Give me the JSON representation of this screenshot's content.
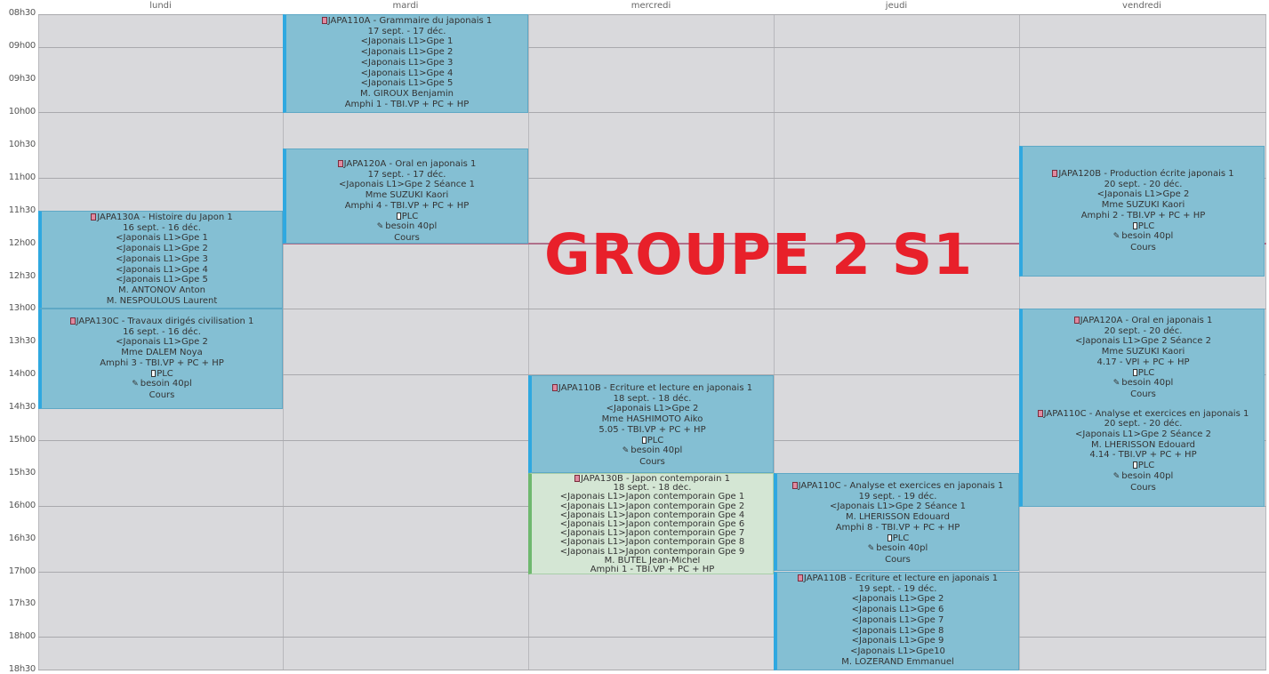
{
  "days": [
    "lundi",
    "mardi",
    "mercredi",
    "jeudi",
    "vendredi"
  ],
  "times": [
    "08h30",
    "09h00",
    "09h30",
    "10h00",
    "10h30",
    "11h00",
    "11h30",
    "12h00",
    "12h30",
    "13h00",
    "13h30",
    "14h00",
    "14h30",
    "15h00",
    "15h30",
    "16h00",
    "16h30",
    "17h00",
    "17h30",
    "18h00",
    "18h30"
  ],
  "overlay_title": "GROUPE 2 S1",
  "events": {
    "mardi_1": {
      "code": "JAPA110A - Grammaire du japonais 1",
      "dates": "17 sept. - 17 déc.",
      "groups": [
        "<Japonais L1>Gpe 1",
        "<Japonais L1>Gpe 2",
        "<Japonais L1>Gpe 3",
        "<Japonais L1>Gpe 4",
        "<Japonais L1>Gpe 5"
      ],
      "teacher": "M. GIROUX Benjamin",
      "room": "Amphi 1 - TBI.VP + PC + HP"
    },
    "mardi_2": {
      "code": "JAPA120A - Oral en japonais 1",
      "dates": "17 sept. - 17 déc.",
      "groups": [
        "<Japonais L1>Gpe 2 Séance 1"
      ],
      "teacher": "Mme SUZUKI Kaori",
      "room": "Amphi 4 - TBI.VP + PC + HP",
      "plc": "PLC",
      "need": "besoin 40pl",
      "type": "Cours"
    },
    "lundi_1": {
      "code": "JAPA130A - Histoire du Japon 1",
      "dates": "16 sept. - 16 déc.",
      "groups": [
        "<Japonais L1>Gpe 1",
        "<Japonais L1>Gpe 2",
        "<Japonais L1>Gpe 3",
        "<Japonais L1>Gpe 4",
        "<Japonais L1>Gpe 5"
      ],
      "teacher": "M. ANTONOV Anton",
      "teacher2": "M. NESPOULOUS Laurent"
    },
    "lundi_2": {
      "code": "JAPA130C - Travaux dirigés civilisation 1",
      "dates": "16 sept. - 16 déc.",
      "groups": [
        "<Japonais L1>Gpe 2"
      ],
      "teacher": "Mme DALEM Noya",
      "room": "Amphi 3 - TBI.VP + PC + HP",
      "plc": "PLC",
      "need": "besoin 40pl",
      "type": "Cours"
    },
    "mercredi_1": {
      "code": "JAPA110B - Ecriture et lecture en japonais 1",
      "dates": "18 sept. - 18 déc.",
      "groups": [
        "<Japonais L1>Gpe 2"
      ],
      "teacher": "Mme HASHIMOTO Aiko",
      "room": "5.05 - TBI.VP + PC + HP",
      "plc": "PLC",
      "need": "besoin 40pl",
      "type": "Cours"
    },
    "mercredi_2": {
      "code": "JAPA130B - Japon contemporain 1",
      "dates": "18 sept. - 18 déc.",
      "groups": [
        "<Japonais L1>Japon contemporain Gpe 1",
        "<Japonais L1>Japon contemporain Gpe 2",
        "<Japonais L1>Japon contemporain Gpe 4",
        "<Japonais L1>Japon contemporain Gpe 6",
        "<Japonais L1>Japon contemporain Gpe 7",
        "<Japonais L1>Japon contemporain Gpe 8",
        "<Japonais L1>Japon contemporain Gpe 9"
      ],
      "teacher": "M. BUTEL Jean-Michel",
      "room": "Amphi 1 - TBI.VP + PC + HP"
    },
    "jeudi_1": {
      "code": "JAPA110C - Analyse et exercices en japonais 1",
      "dates": "19 sept. - 19 déc.",
      "groups": [
        "<Japonais L1>Gpe 2 Séance 1"
      ],
      "teacher": "M. LHERISSON Edouard",
      "room": "Amphi 8 - TBI.VP + PC + HP",
      "plc": "PLC",
      "need": "besoin 40pl",
      "type": "Cours"
    },
    "jeudi_2": {
      "code": "JAPA110B - Ecriture et lecture en japonais 1",
      "dates": "19 sept. - 19 déc.",
      "groups": [
        "<Japonais L1>Gpe 2",
        "<Japonais L1>Gpe 6",
        "<Japonais L1>Gpe 7",
        "<Japonais L1>Gpe 8",
        "<Japonais L1>Gpe 9",
        "<Japonais L1>Gpe10"
      ],
      "teacher": "M. LOZERAND Emmanuel"
    },
    "vendredi_1": {
      "code": "JAPA120B - Production écrite japonais 1",
      "dates": "20 sept. - 20 déc.",
      "groups": [
        "<Japonais L1>Gpe 2"
      ],
      "teacher": "Mme SUZUKI Kaori",
      "room": "Amphi 2 - TBI.VP + PC + HP",
      "plc": "PLC",
      "need": "besoin 40pl",
      "type": "Cours"
    },
    "vendredi_2": {
      "code": "JAPA120A - Oral en japonais 1",
      "dates": "20 sept. - 20 déc.",
      "groups": [
        "<Japonais L1>Gpe 2 Séance 2"
      ],
      "teacher": "Mme SUZUKI Kaori",
      "room": "4.17 - VPI + PC + HP",
      "plc": "PLC",
      "need": "besoin 40pl",
      "type": "Cours",
      "code2": "JAPA110C - Analyse et exercices en japonais 1",
      "dates2": "20 sept. - 20 déc.",
      "groups2": [
        "<Japonais L1>Gpe 2 Séance 2"
      ],
      "teacher2": "M. LHERISSON Edouard",
      "room2": "4.14 - TBI.VP + PC + HP",
      "plc2": "PLC",
      "need2": "besoin 40pl",
      "type2": "Cours"
    }
  }
}
